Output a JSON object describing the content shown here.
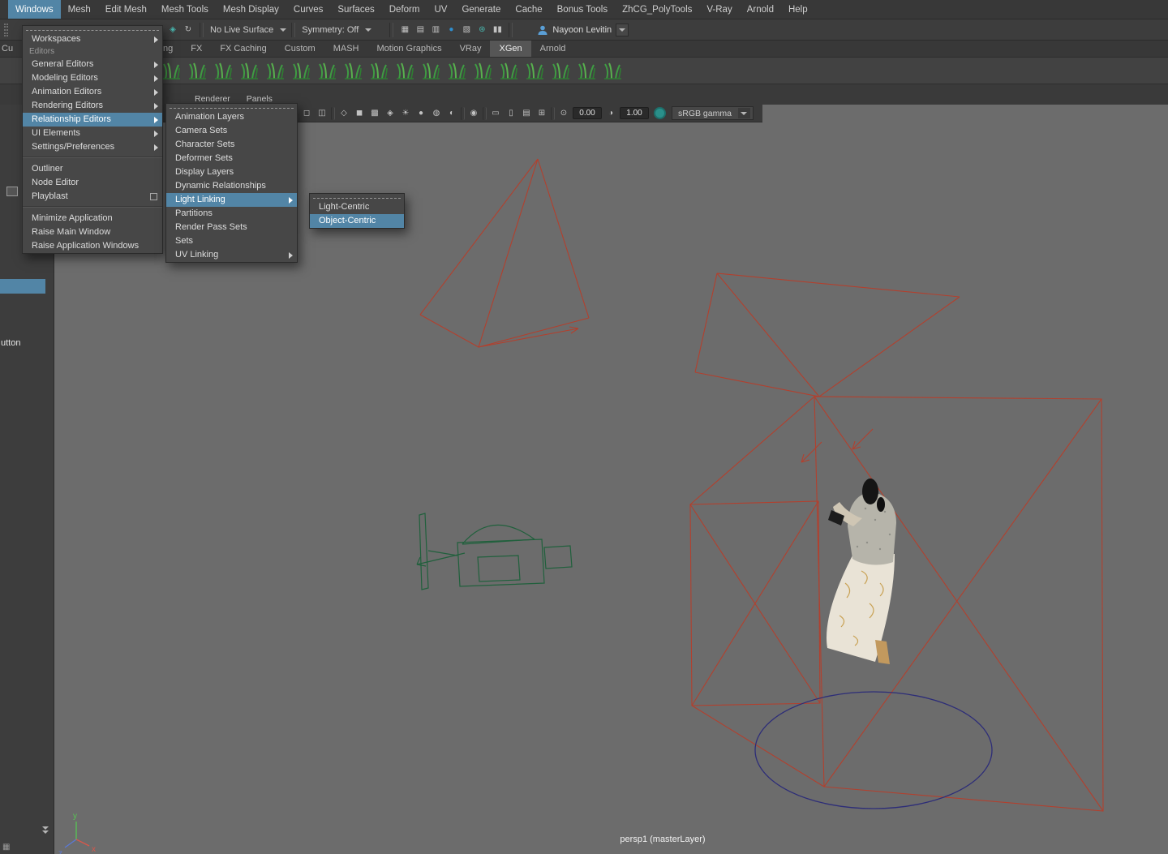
{
  "colors": {
    "highlight": "#5285a6",
    "viewport_bg": "#6c6c6c",
    "wire_red": "#b2402e",
    "wire_green": "#20603c",
    "wire_blue": "#2d2d78"
  },
  "menubar": {
    "items": [
      {
        "label": "Windows",
        "active": true
      },
      {
        "label": "Mesh"
      },
      {
        "label": "Edit Mesh"
      },
      {
        "label": "Mesh Tools"
      },
      {
        "label": "Mesh Display"
      },
      {
        "label": "Curves"
      },
      {
        "label": "Surfaces"
      },
      {
        "label": "Deform"
      },
      {
        "label": "UV"
      },
      {
        "label": "Generate"
      },
      {
        "label": "Cache"
      },
      {
        "label": "Bonus Tools"
      },
      {
        "label": "ZhCG_PolyTools"
      },
      {
        "label": "V-Ray"
      },
      {
        "label": "Arnold"
      },
      {
        "label": "Help"
      }
    ]
  },
  "statusline": {
    "snap_icons": [
      {
        "name": "make-live-icon",
        "glyph": "◈",
        "color": "#49b8b0"
      },
      {
        "name": "construction-history-icon",
        "glyph": "↻",
        "color": "#bdbdbd"
      }
    ],
    "live_surface_label": "No Live Surface",
    "symmetry_label": "Symmetry: Off",
    "render_icons": [
      {
        "name": "render-view-icon",
        "glyph": "▦"
      },
      {
        "name": "render-current-frame-icon",
        "glyph": "▤"
      },
      {
        "name": "ipr-render-icon",
        "glyph": "▥"
      },
      {
        "name": "render-ball-icon",
        "glyph": "●",
        "color": "#2f8fd0"
      },
      {
        "name": "render-settings-icon",
        "glyph": "▧"
      },
      {
        "name": "light-editor-icon",
        "glyph": "⊛",
        "color": "#49b8b0"
      },
      {
        "name": "pause-viewport-icon",
        "glyph": "▮▮"
      }
    ],
    "user_name": "Nayoon Levitin"
  },
  "shelf": {
    "curves_tab_fragment": "Cu",
    "tabs": [
      {
        "label": "ng"
      },
      {
        "label": "FX"
      },
      {
        "label": "FX Caching"
      },
      {
        "label": "Custom"
      },
      {
        "label": "MASH"
      },
      {
        "label": "Motion Graphics"
      },
      {
        "label": "VRay"
      },
      {
        "label": "XGen",
        "active": true
      },
      {
        "label": "Arnold"
      }
    ],
    "icons": [
      {
        "name": "xgen-grass-preset-icon"
      },
      {
        "name": "xgen-grass-preset-icon"
      },
      {
        "name": "xgen-grass-preset-icon"
      },
      {
        "name": "xgen-grass-preset-icon"
      },
      {
        "name": "xgen-grass-preset-icon"
      },
      {
        "name": "xgen-grass-preset-icon"
      },
      {
        "name": "xgen-grass-preset-icon"
      },
      {
        "name": "xgen-grass-preset-icon"
      },
      {
        "name": "xgen-grass-preset-icon"
      },
      {
        "name": "xgen-grass-preset-icon"
      },
      {
        "name": "xgen-grass-preset-icon"
      },
      {
        "name": "xgen-grass-preset-icon"
      },
      {
        "name": "xgen-grass-preset-icon"
      },
      {
        "name": "xgen-grass-preset-icon"
      },
      {
        "name": "xgen-grass-preset-icon"
      },
      {
        "name": "xgen-grass-preset-icon"
      },
      {
        "name": "xgen-grass-preset-icon"
      },
      {
        "name": "xgen-grass-preset-icon"
      }
    ]
  },
  "panel_menu": {
    "items": [
      {
        "label": "Renderer"
      },
      {
        "label": "Panels"
      }
    ]
  },
  "windows_menu": {
    "items": [
      {
        "label": "Workspaces",
        "submenu": true
      },
      {
        "label": "Editors",
        "section": true
      },
      {
        "label": "General Editors",
        "submenu": true
      },
      {
        "label": "Modeling Editors",
        "submenu": true
      },
      {
        "label": "Animation Editors",
        "submenu": true
      },
      {
        "label": "Rendering Editors",
        "submenu": true
      },
      {
        "label": "Relationship Editors",
        "submenu": true,
        "highlighted": true
      },
      {
        "label": "UI Elements",
        "submenu": true
      },
      {
        "label": "Settings/Preferences",
        "submenu": true
      },
      {
        "separator": true
      },
      {
        "label": "Outliner"
      },
      {
        "label": "Node Editor"
      },
      {
        "label": "Playblast",
        "checkbox": true
      },
      {
        "separator": true
      },
      {
        "label": "Minimize Application"
      },
      {
        "label": "Raise Main Window"
      },
      {
        "label": "Raise Application Windows"
      }
    ]
  },
  "relationship_editors_menu": {
    "items": [
      {
        "label": "Animation Layers"
      },
      {
        "label": "Camera Sets"
      },
      {
        "label": "Character Sets"
      },
      {
        "label": "Deformer Sets"
      },
      {
        "label": "Display Layers"
      },
      {
        "label": "Dynamic Relationships"
      },
      {
        "label": "Light Linking",
        "submenu": true,
        "highlighted": true
      },
      {
        "label": "Partitions"
      },
      {
        "label": "Render Pass Sets"
      },
      {
        "label": "Sets"
      },
      {
        "label": "UV Linking",
        "submenu": true
      }
    ]
  },
  "light_linking_menu": {
    "items": [
      {
        "label": "Light-Centric"
      },
      {
        "label": "Object-Centric",
        "highlighted": true
      }
    ]
  },
  "viewport_toolbar": {
    "icons": [
      {
        "name": "single-pane-layout-icon",
        "glyph": "◻"
      },
      {
        "name": "four-pane-layout-icon",
        "glyph": "◫"
      },
      {
        "sep": true
      },
      {
        "name": "wireframe-display-icon",
        "glyph": "◇"
      },
      {
        "name": "shaded-display-icon",
        "glyph": "◼"
      },
      {
        "name": "textured-display-icon",
        "glyph": "▩"
      },
      {
        "name": "wireframe-on-shaded-icon",
        "glyph": "◈"
      },
      {
        "name": "all-lights-icon",
        "glyph": "☀"
      },
      {
        "name": "shadows-icon",
        "glyph": "●"
      },
      {
        "name": "ambient-occlusion-icon",
        "glyph": "◍"
      },
      {
        "name": "motion-blur-icon",
        "glyph": "◐"
      },
      {
        "sep": true
      },
      {
        "name": "isolate-select-icon",
        "glyph": "◉"
      },
      {
        "sep": true
      },
      {
        "name": "film-gate-icon",
        "glyph": "▭"
      },
      {
        "name": "resolution-gate-icon",
        "glyph": "▯"
      },
      {
        "name": "gate-mask-icon",
        "glyph": "▤"
      },
      {
        "name": "field-chart-icon",
        "glyph": "⊞"
      },
      {
        "sep": true
      },
      {
        "name": "exposure-icon",
        "glyph": "⊙"
      }
    ],
    "exposure_value": "0.00",
    "gamma_icon_glyph": "◑",
    "gamma_value": "1.00",
    "view_transform": "sRGB gamma"
  },
  "viewport": {
    "hud_label": "persp1 (masterLayer)",
    "axis": {
      "x": "x",
      "y": "y",
      "z": "z"
    }
  },
  "sidebar": {
    "button_fragment": "utton"
  }
}
